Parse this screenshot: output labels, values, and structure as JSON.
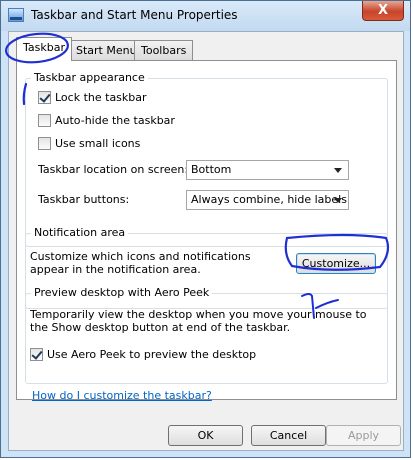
{
  "window": {
    "title": "Taskbar and Start Menu Properties",
    "close_label": "X"
  },
  "tabs": [
    {
      "label": "Taskbar",
      "active": true
    },
    {
      "label": "Start Menu",
      "active": false
    },
    {
      "label": "Toolbars",
      "active": false
    }
  ],
  "appearance": {
    "group_title": "Taskbar appearance",
    "lock_label": "Lock the taskbar",
    "lock_checked": true,
    "autohide_label": "Auto-hide the taskbar",
    "autohide_checked": false,
    "small_icons_label": "Use small icons",
    "small_icons_checked": false,
    "location_label": "Taskbar location on screen:",
    "location_value": "Bottom",
    "buttons_label": "Taskbar buttons:",
    "buttons_value": "Always combine, hide labels"
  },
  "notification": {
    "group_title": "Notification area",
    "description": "Customize which icons and notifications appear in the notification area.",
    "customize_label": "Customize..."
  },
  "aero_peek": {
    "group_title": "Preview desktop with Aero Peek",
    "description": "Temporarily view the desktop when you move your mouse to the Show desktop button at end of the taskbar.",
    "use_label": "Use Aero Peek to preview the desktop",
    "use_checked": true
  },
  "help_link": "How do I customize the taskbar?",
  "footer": {
    "ok_label": "OK",
    "cancel_label": "Cancel",
    "apply_label": "Apply"
  },
  "annotation": {
    "mark_text": "1",
    "ink_color": "#1f2fd6"
  }
}
